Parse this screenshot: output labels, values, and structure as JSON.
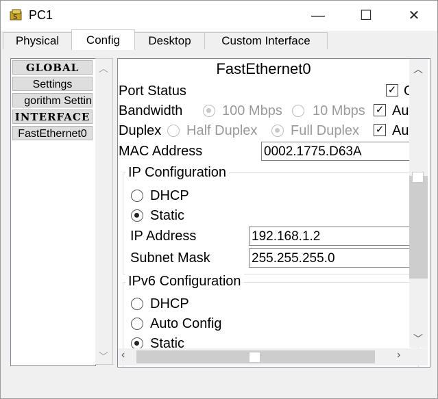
{
  "window": {
    "title": "PC1",
    "minimize": "—",
    "maximize": "☐",
    "close": "✕"
  },
  "tabs": [
    {
      "label": "Physical"
    },
    {
      "label": "Config"
    },
    {
      "label": "Desktop"
    },
    {
      "label": "Custom Interface"
    }
  ],
  "active_tab": "Config",
  "sidebar": {
    "items": [
      {
        "label": "GLOBAL"
      },
      {
        "label": "Settings"
      },
      {
        "label": "gorithm Settin"
      },
      {
        "label": "INTERFACE"
      },
      {
        "label": "FastEthernet0"
      }
    ]
  },
  "panel": {
    "title": "FastEthernet0",
    "port_status": {
      "label": "Port Status",
      "checkbox_text": "O",
      "checked": true
    },
    "bandwidth": {
      "label": "Bandwidth",
      "opt1": "100 Mbps",
      "opt2": "10 Mbps",
      "auto": "Au",
      "auto_checked": true
    },
    "duplex": {
      "label": "Duplex",
      "opt1": "Half Duplex",
      "opt2": "Full Duplex",
      "auto": "Au",
      "auto_checked": true
    },
    "mac": {
      "label": "MAC Address",
      "value": "0002.1775.D63A"
    },
    "ip_config": {
      "title": "IP Configuration",
      "dhcp": "DHCP",
      "static": "Static",
      "selected": "Static",
      "ip_label": "IP Address",
      "ip_value": "192.168.1.2",
      "mask_label": "Subnet Mask",
      "mask_value": "255.255.255.0"
    },
    "ipv6_config": {
      "title": "IPv6 Configuration",
      "dhcp": "DHCP",
      "auto": "Auto Config",
      "static": "Static",
      "selected": "Static"
    }
  },
  "icons": {
    "app": "packet-tracer-pc-icon",
    "up": "chevron-up-icon",
    "down": "chevron-down-icon",
    "left": "chevron-left-icon",
    "right": "chevron-right-icon"
  }
}
